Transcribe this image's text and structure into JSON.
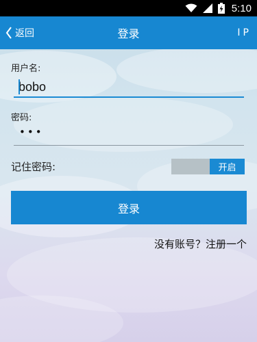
{
  "status_bar": {
    "time": "5:10",
    "icons": [
      "wifi-icon",
      "signal-icon",
      "battery-charging-icon"
    ]
  },
  "header": {
    "back_label": "返回",
    "title": "登录",
    "right_action": "IP"
  },
  "form": {
    "username_label": "用户名:",
    "username_value": "bobo",
    "password_label": "密码:",
    "password_masked": "•••",
    "remember_label": "记住密码:",
    "remember_toggle_label": "开启",
    "remember_enabled": true
  },
  "login_button_label": "登录",
  "register_link": "没有账号？注册一个",
  "colors": {
    "accent": "#1787d1",
    "status_bar": "#000000"
  }
}
